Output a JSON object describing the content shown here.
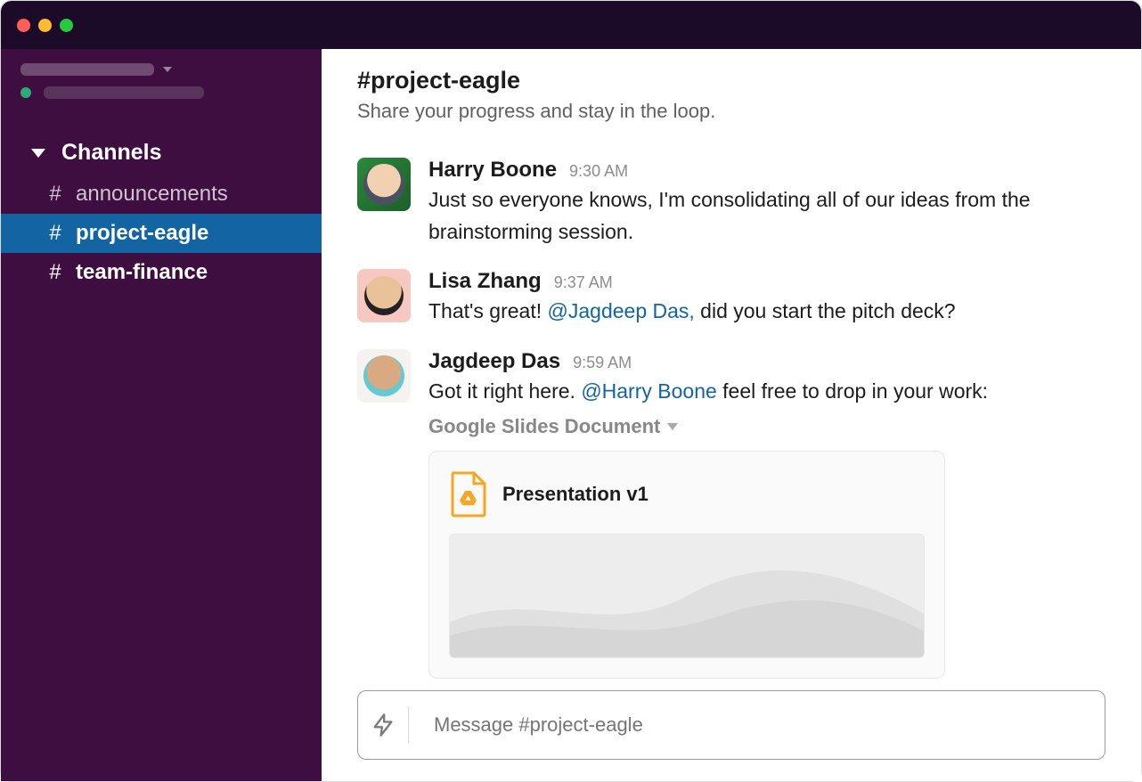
{
  "sidebar": {
    "section_label": "Channels",
    "items": [
      {
        "name": "announcements",
        "bold": false,
        "active": false
      },
      {
        "name": "project-eagle",
        "bold": true,
        "active": true
      },
      {
        "name": "team-finance",
        "bold": true,
        "active": false
      }
    ]
  },
  "channel": {
    "hash_name": "#project-eagle",
    "topic": "Share your progress and stay in the loop."
  },
  "messages": [
    {
      "author": "Harry Boone",
      "time": "9:30 AM",
      "text_pre": "Just so everyone knows, I'm consolidating all of our ideas from the brainstorming session.",
      "mention": "",
      "text_post": ""
    },
    {
      "author": "Lisa Zhang",
      "time": "9:37 AM",
      "text_pre": "That's great! ",
      "mention": "@Jagdeep Das,",
      "text_post": " did you start the pitch deck?"
    },
    {
      "author": "Jagdeep Das",
      "time": "9:59 AM",
      "text_pre": "Got it right here. ",
      "mention": "@Harry Boone",
      "text_post": " feel free to drop in your work:"
    }
  ],
  "attachment": {
    "source_label": "Google Slides Document",
    "file_title": "Presentation v1"
  },
  "compose": {
    "placeholder": "Message #project-eagle"
  }
}
